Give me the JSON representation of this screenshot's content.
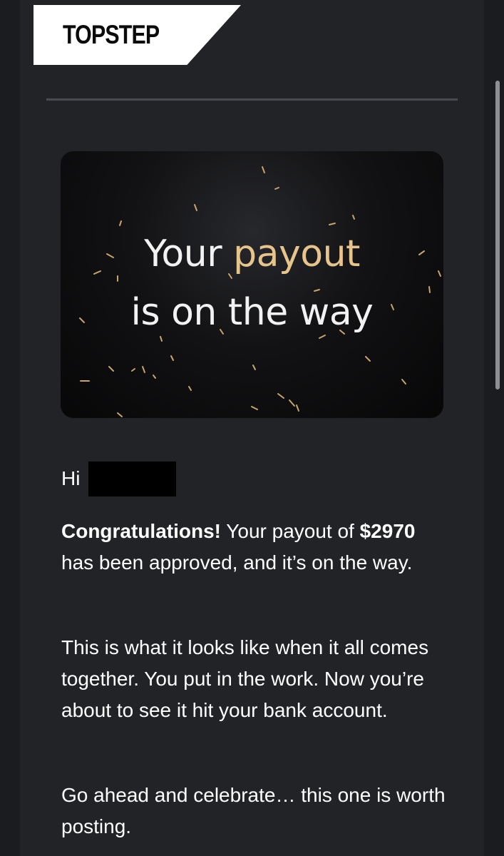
{
  "header": {
    "logo_text": "TOPSTEP"
  },
  "hero": {
    "line1_start": "Your",
    "line1_highlight": "payout",
    "line2": "is on the way",
    "highlight_color": "#e6c48c"
  },
  "body": {
    "greeting": "Hi",
    "paragraph1": {
      "bold_lead": "Congratulations!",
      "text_a": " Your payout of ",
      "amount": "$2970",
      "text_b": " has been approved, and it’s on the way."
    },
    "paragraph2": "This is what it looks like when it all comes together. You put in the work. Now you’re about to see it hit your bank account.",
    "paragraph3": "Go ahead and celebrate… this one is worth posting."
  },
  "colors": {
    "background": "#1b1c20",
    "panel": "#222327",
    "text": "#ffffff"
  }
}
